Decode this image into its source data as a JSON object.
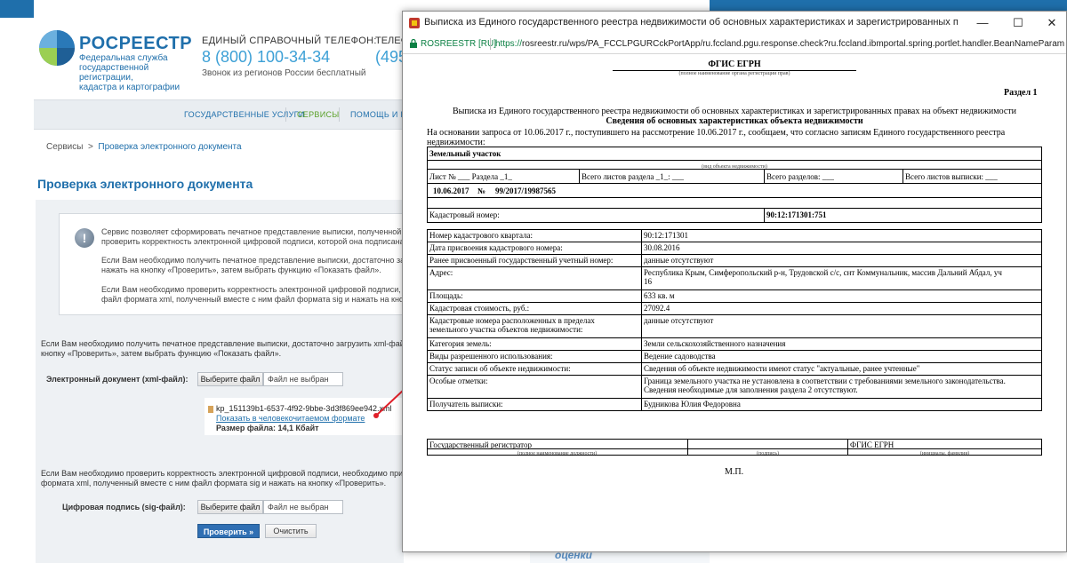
{
  "background_page": {
    "brand": {
      "name": "РОСРЕЕСТР",
      "subtitle": [
        "Федеральная служба",
        "государственной регистрации,",
        "кадастра и картографии"
      ]
    },
    "phone": {
      "label": "ЕДИНЫЙ СПРАВОЧНЫЙ ТЕЛЕФОН:",
      "number": "8 (800) 100-34-34",
      "note": "Звонок из регионов России бесплатный",
      "label2": "ТЕЛЕФ",
      "number2": "(495"
    },
    "nav": [
      "ГОСУДАРСТВЕННЫЕ УСЛУГИ",
      "СЕРВИСЫ",
      "ПОМОЩЬ И ПО"
    ],
    "breadcrumb": {
      "root": "Сервисы",
      "separator": ">",
      "current": "Проверка электронного документа"
    },
    "page_title": "Проверка электронного документа",
    "notice_lines": [
      "Сервис позволяет сформировать печатное представление выписки, полученной в",
      "проверить корректность электронной цифровой подписи, которой она подписана.",
      "Если Вам необходимо получить печатное представление выписки, достаточно загр",
      "нажать на кнопку «Проверить», затем выбрать функцию «Показать файл».",
      "Если Вам необходимо проверить корректность электронной цифровой подписи, не",
      "файл формата xml, полученный вместе с ним файл формата sig и нажать на кноп"
    ],
    "section1_lines": [
      "Если Вам необходимо получить печатное представление выписки, достаточно загрузить xml-файл в",
      "кнопку «Проверить», затем выбрать функцию «Показать файл»."
    ],
    "xml_field": {
      "label": "Электронный документ (xml-файл):",
      "button": "Выберите файл",
      "status": "Файл не выбран"
    },
    "uploaded_file": {
      "name": "kp_151139b1-6537-4f92-9bbe-3d3f869ee942.xml",
      "link": "Показать в человекочитаемом формате",
      "size": "Размер файла: 14,1 Кбайт"
    },
    "section2_lines": [
      "Если Вам необходимо проверить корректность электронной цифровой подписи, необходимо прикре",
      "формата xml, полученный вместе с ним файл формата sig и нажать на кнопку «Проверить»."
    ],
    "sig_field": {
      "label": "Цифровая подпись (sig-файл):",
      "button": "Выберите файл",
      "status": "Файл не выбран"
    },
    "check_button": "Проверить »",
    "clear_button": "Очистить",
    "bottom_word": "оценки",
    "colors": {
      "brand_blue": "#1f6fab",
      "accent_blue": "#3da0d6",
      "arrow_red": "#e0202a"
    }
  },
  "popup": {
    "window_title": "Выписка из Единого государственного реестра недвижимости об основных характеристиках и зарегистрированных правах - Google Chrome",
    "controls": {
      "minimize": "—",
      "maximize": "☐",
      "close": "✕"
    },
    "site_id": "ROSREESTR [RU]",
    "url_scheme": "https://",
    "url_rest": "rosreestr.ru/wps/PA_FCCLPGURCckPortApp/ru.fccland.pgu.response.check?ru.fccland.ibmportal.spring.portlet.handler.BeanNameParam",
    "document": {
      "org": "ФГИС ЕГРН",
      "org_caption": "(полное наименование органа регистрации прав)",
      "section": "Раздел 1",
      "title": "Выписка из Единого государственного реестра недвижимости об основных характеристиках и зарегистрированных правах на объект недвижимости",
      "subtitle": "Сведения об основных характеристиках объекта недвижимости",
      "basis_line1": "На основании запроса от 10.06.2017 г., поступившего на рассмотрение 10.06.2017 г., сообщаем, что согласно записям Единого государственного реестра",
      "basis_line2": "недвижимости:",
      "object_type": "Земельный участок",
      "object_type_caption": "(вид объекта недвижимости)",
      "sheet": "Лист № ___ Раздела _1_",
      "sheets_section": "Всего листов раздела _1_: ___",
      "sections_total": "Всего разделов: ___",
      "sheets_total": "Всего листов выписки: ___",
      "date": "10.06.2017",
      "number_sign": "№",
      "number": "99/2017/19987565",
      "cadastral_label": "Кадастровый номер:",
      "cadastral_number": "90:12:171301:751",
      "rows": [
        {
          "label": [
            "Номер кадастрового квартала:"
          ],
          "value": [
            "90:12:171301"
          ]
        },
        {
          "label": [
            "Дата присвоения кадастрового номера:"
          ],
          "value": [
            "30.08.2016"
          ]
        },
        {
          "label": [
            "Ранее присвоенный государственный учетный номер:"
          ],
          "value": [
            "данные отсутствуют"
          ]
        },
        {
          "label": [
            "Адрес:"
          ],
          "value": [
            "Республика Крым, Симферопольский р-н, Трудовской с/с, снт Коммунальник, массив Дальний Абдал, уч",
            "16"
          ]
        },
        {
          "label": [
            "Площадь:"
          ],
          "value": [
            "633 кв. м"
          ]
        },
        {
          "label": [
            "Кадастровая стоимость, руб.:"
          ],
          "value": [
            "27092.4"
          ]
        },
        {
          "label": [
            "Кадастровые номера расположенных в пределах",
            "земельного участка объектов недвижимости:"
          ],
          "value": [
            "данные отсутствуют"
          ]
        },
        {
          "label": [
            "Категория земель:"
          ],
          "value": [
            "Земли сельскохозяйственного назначения"
          ]
        },
        {
          "label": [
            "Виды разрешенного использования:"
          ],
          "value": [
            "Ведение садоводства"
          ]
        },
        {
          "label": [
            "Статус записи об объекте недвижимости:"
          ],
          "value": [
            "Сведения об объекте недвижимости имеют статус \"актуальные, ранее учтенные\""
          ]
        },
        {
          "label": [
            "Особые отметки:"
          ],
          "value": [
            "Граница земельного участка не установлена в соответствии с требованиями земельного законодательства.",
            "Сведения необходимые для заполнения раздела 2 отсутствуют."
          ]
        },
        {
          "label": [
            "Получатель выписки:"
          ],
          "value": [
            "Будникова Юлия Федоровна"
          ]
        }
      ],
      "signature": {
        "position": "Государственный регистратор",
        "position_caption": "(полное наименование должности)",
        "sign_caption": "(подпись)",
        "name": "ФГИС ЕГРН",
        "name_caption": "(инициалы, фамилия)"
      },
      "stamp": "М.П."
    }
  }
}
